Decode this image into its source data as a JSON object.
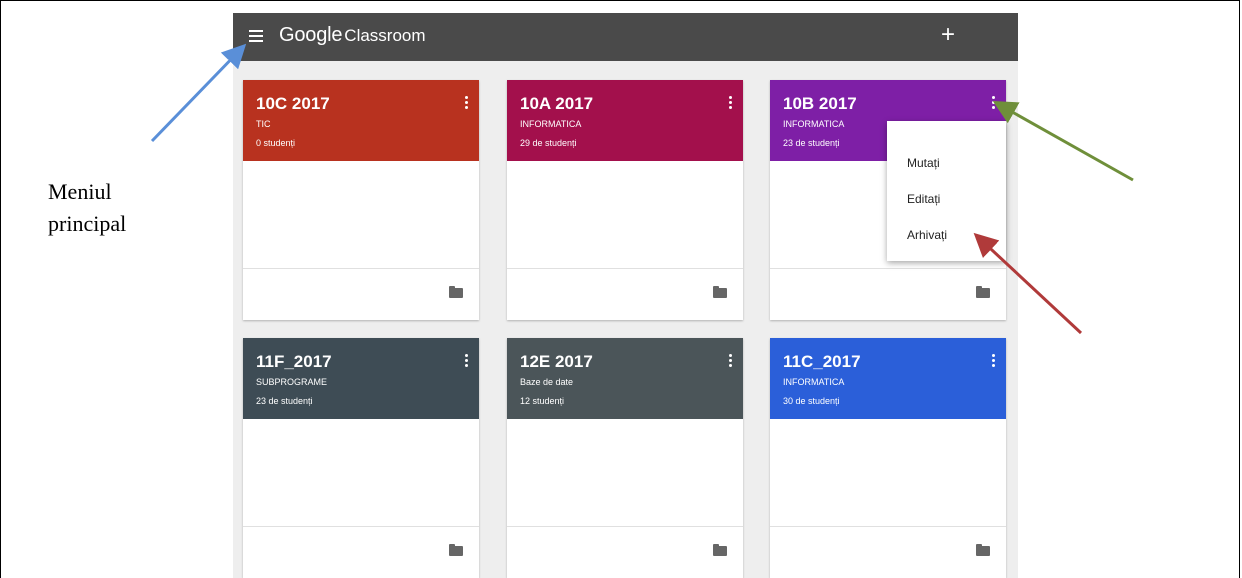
{
  "caption": {
    "line1": "Meniul",
    "line2": "principal"
  },
  "topbar": {
    "brand_google": "Google",
    "brand_classroom": "Classroom",
    "add_label": "+"
  },
  "classes": [
    {
      "name": "10C 2017",
      "section": "TIC",
      "students": "0 studenți",
      "color": "#b8321f"
    },
    {
      "name": "10A 2017",
      "section": "INFORMATICA",
      "students": "29 de studenți",
      "color": "#a3104c"
    },
    {
      "name": "10B 2017",
      "section": "INFORMATICA",
      "students": "23 de studenți",
      "color": "#7e1fa6"
    },
    {
      "name": "11F_2017",
      "section": "SUBPROGRAME",
      "students": "23 de studenți",
      "color": "#3e4c55"
    },
    {
      "name": "12E 2017",
      "section": "Baze de date",
      "students": "12 studenți",
      "color": "#4b5559"
    },
    {
      "name": "11C_2017",
      "section": "INFORMATICA",
      "students": "30 de studenți",
      "color": "#2b5fd9"
    }
  ],
  "context_menu": {
    "items": [
      "Mutați",
      "Editați",
      "Arhivați"
    ]
  },
  "annotation_colors": {
    "blue": "#5a8fd8",
    "green": "#6f8f3a",
    "red": "#b03a3a"
  }
}
